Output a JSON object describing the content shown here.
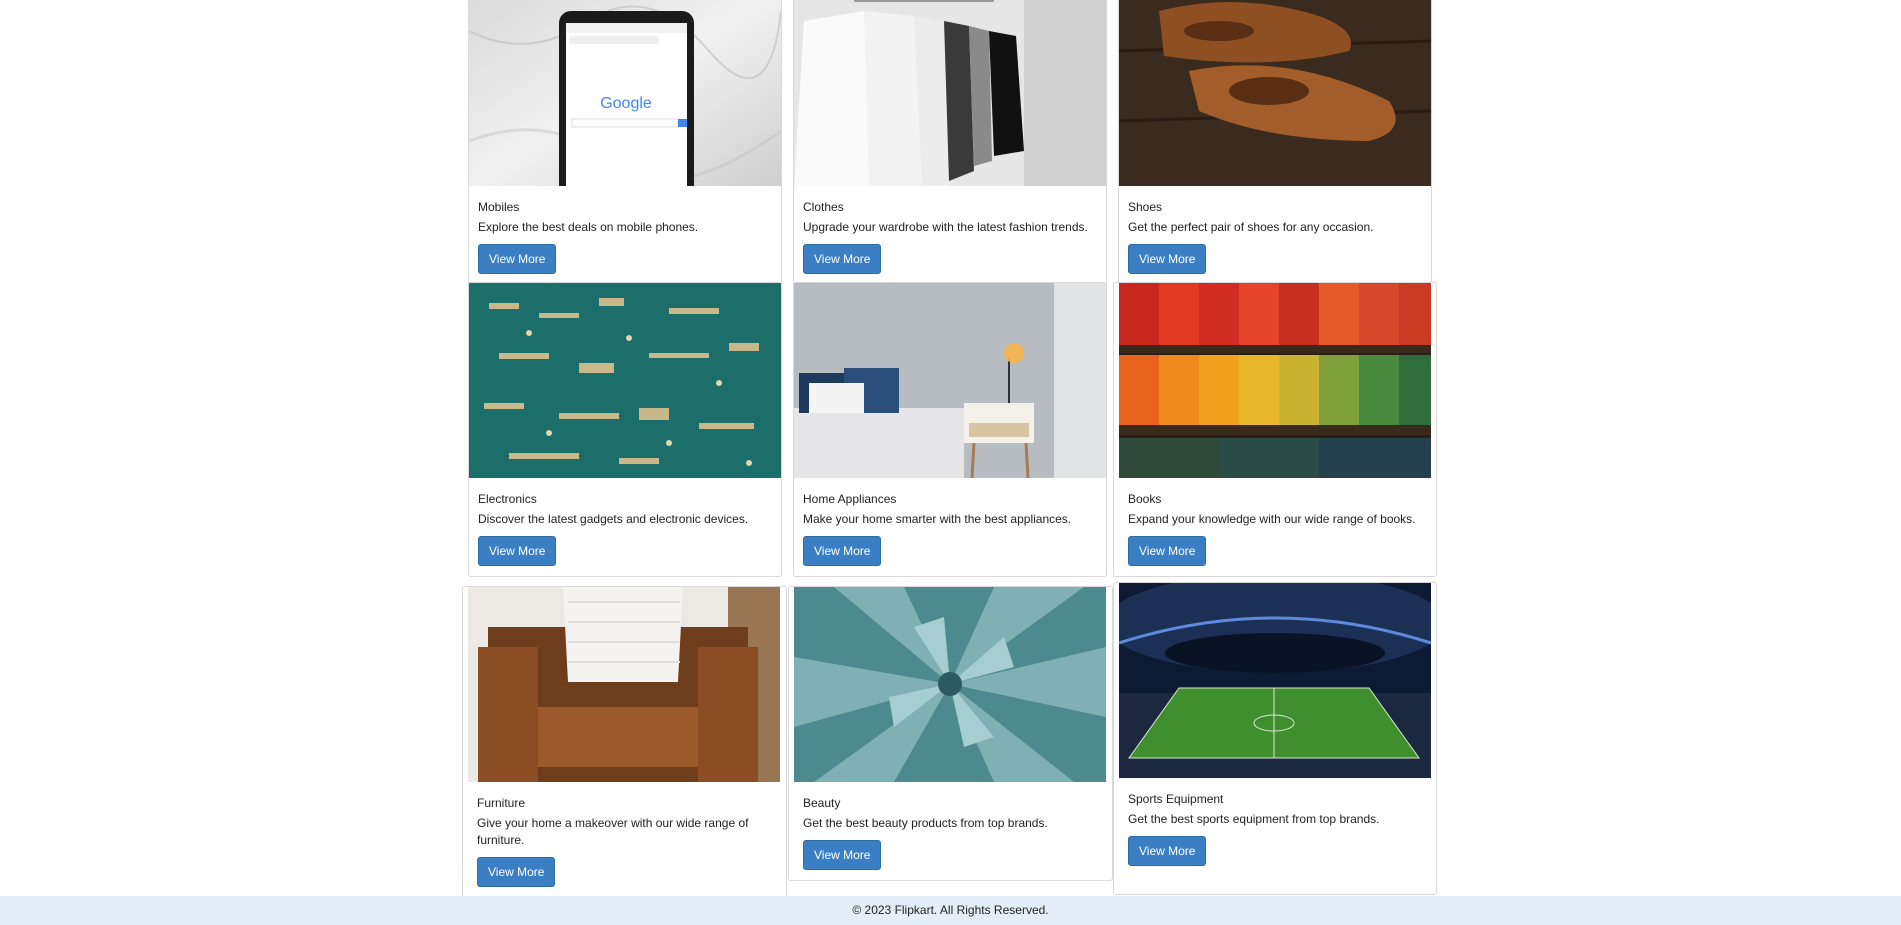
{
  "cards": [
    {
      "title": "Mobiles",
      "desc": "Explore the best deals on mobile phones.",
      "button": "View More",
      "image": "smartphone-on-marble"
    },
    {
      "title": "Clothes",
      "desc": "Upgrade your wardrobe with the latest fashion trends.",
      "button": "View More",
      "image": "clothes-on-hangers"
    },
    {
      "title": "Shoes",
      "desc": "Get the perfect pair of shoes for any occasion.",
      "button": "View More",
      "image": "brown-leather-shoes"
    },
    {
      "title": "Electronics",
      "desc": "Discover the latest gadgets and electronic devices.",
      "button": "View More",
      "image": "circuit-board"
    },
    {
      "title": "Home Appliances",
      "desc": "Make your home smarter with the best appliances.",
      "button": "View More",
      "image": "bedroom-lamp"
    },
    {
      "title": "Books",
      "desc": "Expand your knowledge with our wide range of books.",
      "button": "View More",
      "image": "colorful-bookshelf"
    },
    {
      "title": "Furniture",
      "desc": "Give your home a makeover with our wide range of furniture.",
      "button": "View More",
      "image": "leather-armchair"
    },
    {
      "title": "Beauty",
      "desc": "Get the best beauty products from top brands.",
      "button": "View More",
      "image": "succulent-plant"
    },
    {
      "title": "Sports Equipment",
      "desc": "Get the best sports equipment from top brands.",
      "button": "View More",
      "image": "football-stadium"
    }
  ],
  "phone_screen": {
    "brand": "Google"
  },
  "footer": {
    "text": "© 2023 Flipkart. All Rights Reserved."
  },
  "colors": {
    "button": "#3a7fc3",
    "footer_bg": "#e3eef9"
  }
}
